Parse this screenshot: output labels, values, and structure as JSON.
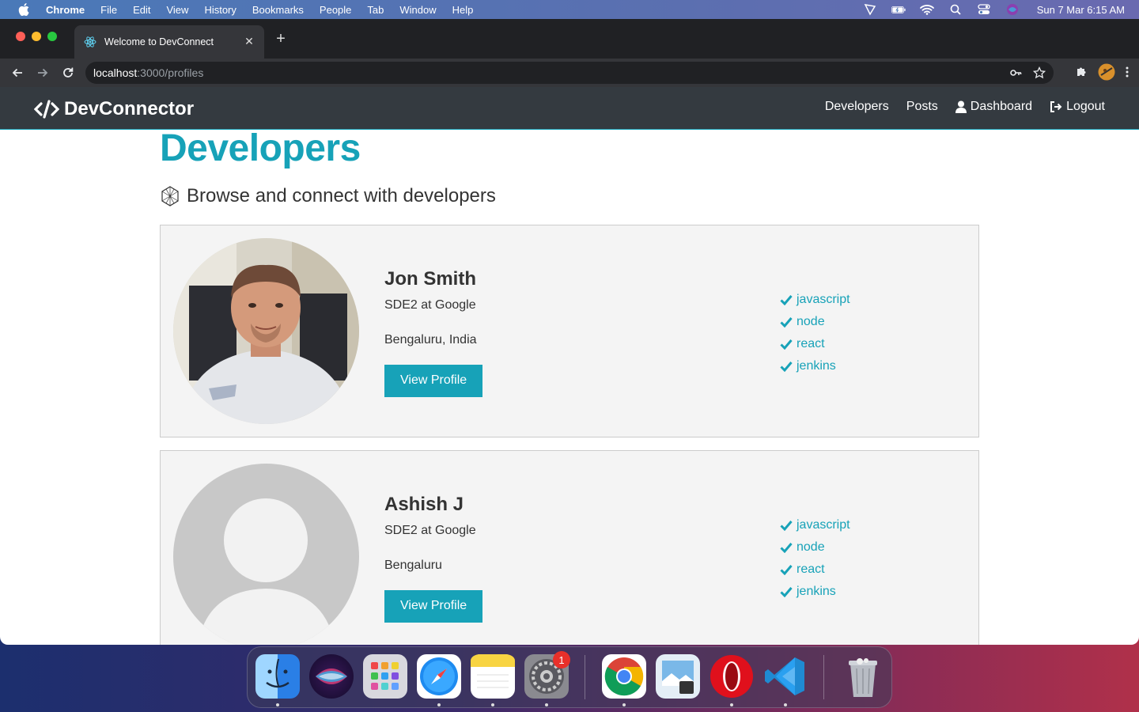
{
  "menubar": {
    "app_name": "Chrome",
    "items": [
      "File",
      "Edit",
      "View",
      "History",
      "Bookmarks",
      "People",
      "Tab",
      "Window",
      "Help"
    ],
    "clock": "Sun 7 Mar  6:15 AM"
  },
  "browser": {
    "tab_title": "Welcome to DevConnect",
    "url_host": "localhost",
    "url_path": ":3000/profiles"
  },
  "navbar": {
    "brand": "DevConnector",
    "links": [
      "Developers",
      "Posts",
      "Dashboard",
      "Logout"
    ]
  },
  "page": {
    "title": "Developers",
    "lead": "Browse and connect with developers",
    "view_profile_label": "View Profile"
  },
  "profiles": [
    {
      "name": "Jon Smith",
      "status": "SDE2 at Google",
      "location": "Bengaluru, India",
      "skills": [
        "javascript",
        "node",
        "react",
        "jenkins"
      ]
    },
    {
      "name": "Ashish J",
      "status": "SDE2 at Google",
      "location": "Bengaluru",
      "skills": [
        "javascript",
        "node",
        "react",
        "jenkins"
      ]
    }
  ],
  "dock": {
    "apps": [
      "finder-icon",
      "siri-icon",
      "launchpad-icon",
      "safari-icon",
      "notes-icon",
      "system-preferences-icon",
      "chrome-icon",
      "preview-icon",
      "opera-icon",
      "vscode-icon",
      "trash-icon"
    ],
    "system_preferences_badge": "1"
  },
  "colors": {
    "accent": "#17a2b8",
    "navbar_bg": "#343a40",
    "card_bg": "#f4f4f4"
  }
}
